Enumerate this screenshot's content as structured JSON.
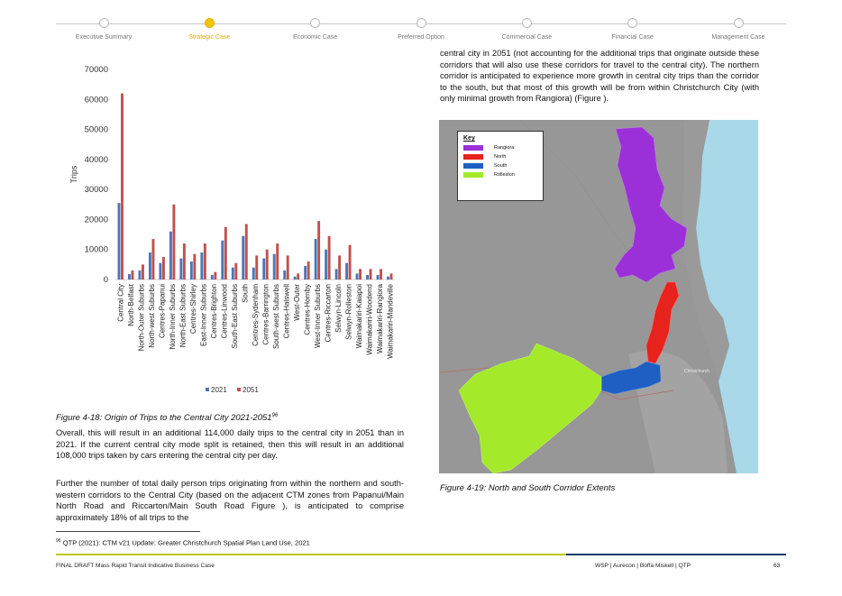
{
  "nav": {
    "steps": [
      {
        "label": "Executive Summary",
        "active": false
      },
      {
        "label": "Strategic Case",
        "active": true
      },
      {
        "label": "Economic Case",
        "active": false
      },
      {
        "label": "Preferred Option",
        "active": false
      },
      {
        "label": "Commercial Case",
        "active": false
      },
      {
        "label": "Financial Case",
        "active": false
      },
      {
        "label": "Management Case",
        "active": false
      }
    ],
    "active_color": "#f1c40f"
  },
  "chart_data": {
    "type": "bar",
    "ylabel": "Trips",
    "ylim": [
      0,
      70000
    ],
    "yticks": [
      0,
      10000,
      20000,
      30000,
      40000,
      50000,
      60000,
      70000
    ],
    "categories": [
      "Central City",
      "North-Belfast",
      "North-Outer Suburbs",
      "North-west Suburbs",
      "Centres-Papanui",
      "North-Inner Suburbs",
      "North-East Suburbs",
      "Centres-Shirley",
      "East-Inner Suburbs",
      "Centres-Brighton",
      "Centres-Linwood",
      "South-East Suburbs",
      "South",
      "Centres-Sydenham",
      "Centres-Barrington",
      "South-west Suburbs",
      "Centres-Halswell",
      "West-Outer",
      "Centres-Hornby",
      "West-Inner Suburbs",
      "Centres-Riccarton",
      "Selwyn-Lincoln",
      "Selwyn-Rolleston",
      "Waimakariri-Kaiapoi",
      "Waimakariri-Woodend",
      "Waimakariri-Rangiora",
      "Waimakariri-Mandeville"
    ],
    "series": [
      {
        "name": "2021",
        "color": "#4a76b8",
        "values": [
          25500,
          1800,
          3000,
          9000,
          5500,
          16000,
          7000,
          6000,
          9000,
          1500,
          13000,
          4000,
          14500,
          4000,
          7000,
          8500,
          3000,
          1000,
          4500,
          13500,
          10000,
          3500,
          5500,
          2000,
          1500,
          1500,
          1000
        ]
      },
      {
        "name": "2051",
        "color": "#c0504d",
        "values": [
          62000,
          3000,
          5000,
          13500,
          7500,
          25000,
          12000,
          8500,
          12000,
          2500,
          17500,
          5500,
          18500,
          8000,
          10000,
          12000,
          8000,
          2000,
          6000,
          19500,
          14500,
          8000,
          11500,
          3500,
          3500,
          3500,
          2000
        ]
      }
    ],
    "legend": "bottom"
  },
  "figure_4_18": {
    "caption": "Figure 4-18: Origin of Trips to the Central City 2021-2051",
    "footnote_ref": "96"
  },
  "text": {
    "right_para": "central city in 2051 (not accounting for the additional trips that originate outside these corridors that will also use these corridors for travel to the central city). The northern corridor is anticipated to experience more growth in central city trips than the corridor to the south, but that most of this growth will be from within Christchurch City (with only minimal growth from Rangiora) (Figure ).",
    "left_para_1": "Overall, this will result in an additional 114,000 daily trips to the central city in 2051 than in 2021. If the current central city mode split is retained, then this will result in an additional 108,000 trips taken by cars entering the central city per day.",
    "left_para_2": "Further the number of total daily person trips originating from within the northern and south-western corridors to the Central City (based on the adjacent CTM zones from Papanui/Main North Road and Riccarton/Main South Road Figure ), is anticipated to comprise approximately 18% of all trips to the"
  },
  "map": {
    "key_title": "Key",
    "key_items": [
      {
        "label": "Rangiora",
        "color": "#9b30d9"
      },
      {
        "label": "North",
        "color": "#e8221c"
      },
      {
        "label": "South",
        "color": "#1f5fc4"
      },
      {
        "label": "Rolleston",
        "color": "#a4ea2a"
      }
    ],
    "place_labels": [
      "Christchurch"
    ],
    "caption": "Figure 4-19: North and South Corridor Extents",
    "colors": {
      "land": "#9a9a9a",
      "sea": "#a9d8e8",
      "coast": "#b8e3f0"
    }
  },
  "footnote": {
    "number": "96",
    "text": "QTP (2021): CTM v21 Update: Greater Christchurch Spatial Plan Land Use, 2021"
  },
  "footer": {
    "left": "FINAL DRAFT Mass Rapid Transit Indicative Business Case",
    "right": "WSP | Aurecon | Boffa Miskell | QTP",
    "page": "63",
    "line_colors": [
      "#b8c91b",
      "#1e3a6a"
    ]
  }
}
